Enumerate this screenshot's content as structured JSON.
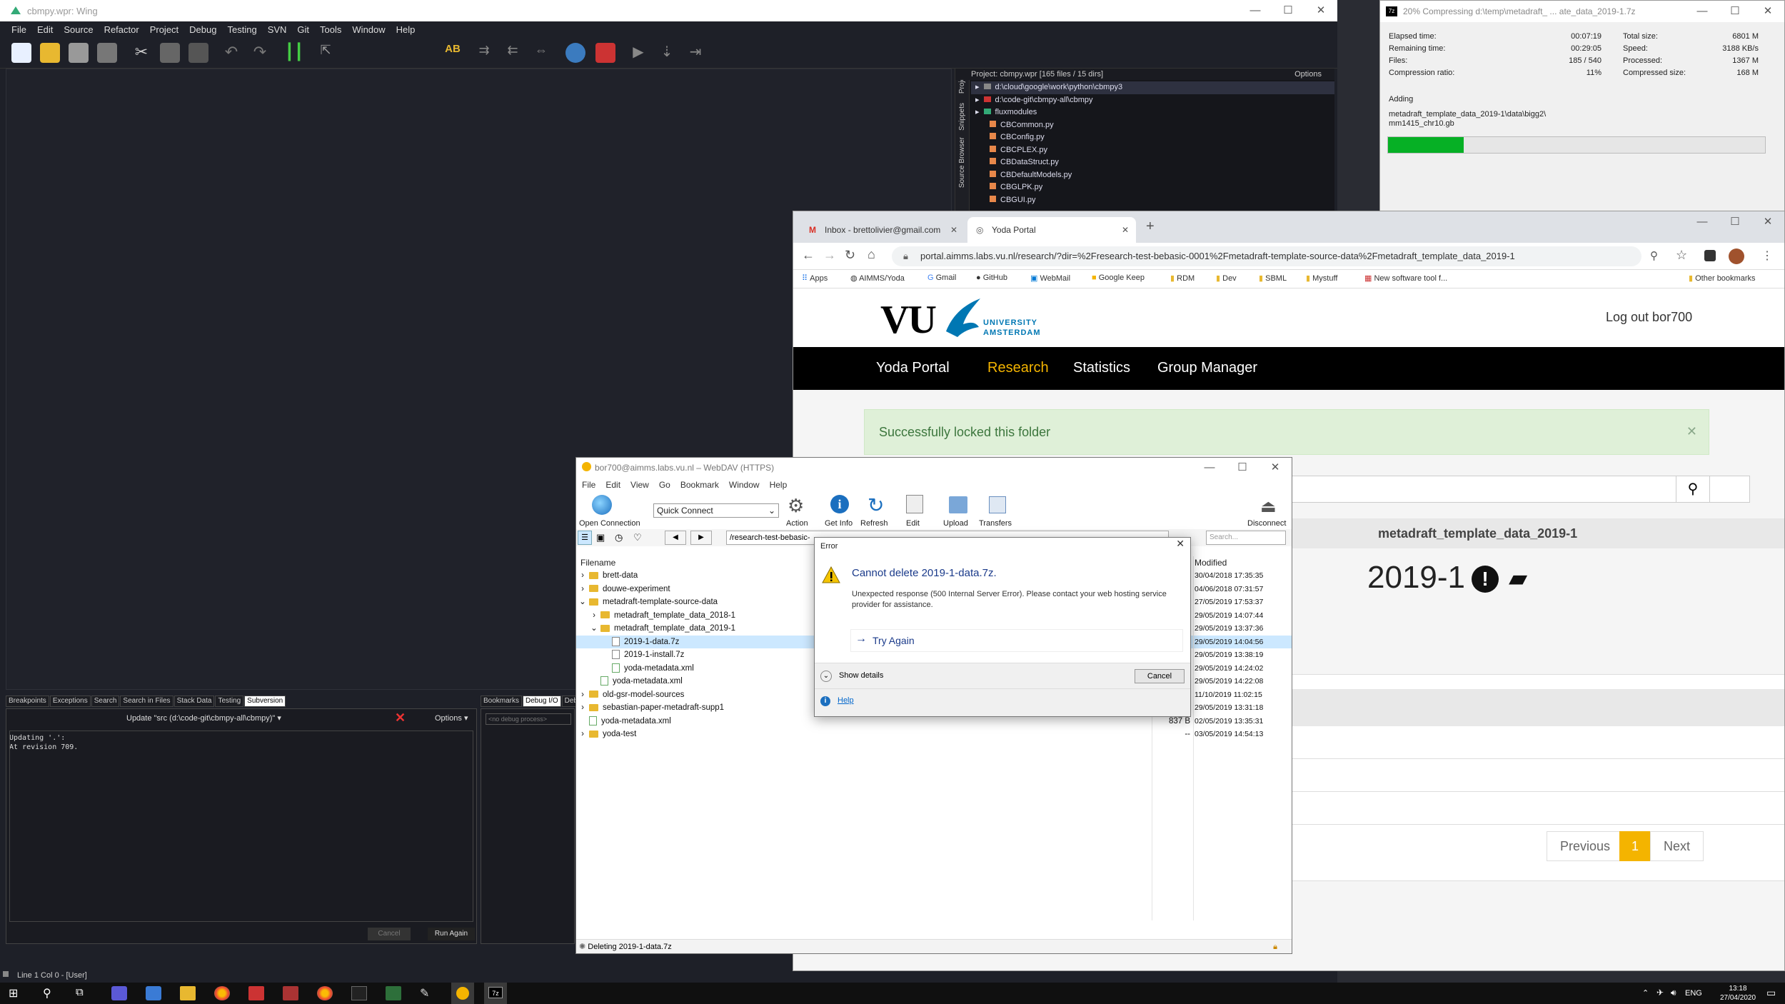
{
  "wing": {
    "title": "cbmpy.wpr: Wing",
    "menu": [
      "File",
      "Edit",
      "Source",
      "Refactor",
      "Project",
      "Debug",
      "Testing",
      "SVN",
      "Git",
      "Tools",
      "Window",
      "Help"
    ],
    "project_header": "Project: cbmpy.wpr [165 files / 15 dirs]",
    "project_options": "Options",
    "project_tabs": [
      "Project",
      "Snippets",
      "Source Browser"
    ],
    "project_items": [
      "d:\\cloud\\google\\work\\python\\cbmpy3",
      "d:\\code-git\\cbmpy-all\\cbmpy",
      "fluxmodules",
      "CBCommon.py",
      "CBConfig.py",
      "CBCPLEX.py",
      "CBDataStruct.py",
      "CBDefaultModels.py",
      "CBGLPK.py",
      "CBGUI.py"
    ],
    "bottom_tabs": [
      "Breakpoints",
      "Exceptions",
      "Search",
      "Search in Files",
      "Stack Data",
      "Testing",
      "Subversion"
    ],
    "bottom_tabs_right": [
      "Bookmarks",
      "Debug I/O",
      "Debu"
    ],
    "svn_command": "Update \"src (d:\\code-git\\cbmpy-all\\cbmpy)\"",
    "svn_options": "Options",
    "svn_output": [
      "Updating '.':",
      "At revision 709."
    ],
    "debug_process": "<no debug process>",
    "cancel_label": "Cancel",
    "run_again_label": "Run Again",
    "status": "Line 1 Col 0 - [User]"
  },
  "sevenzip": {
    "title": "20% Compressing d:\\temp\\metadraft_ ... ate_data_2019-1.7z",
    "left": [
      {
        "k": "Elapsed time:",
        "v": "00:07:19"
      },
      {
        "k": "Remaining time:",
        "v": "00:29:05"
      },
      {
        "k": "Files:",
        "v": "185 / 540"
      },
      {
        "k": "Compression ratio:",
        "v": "11%"
      }
    ],
    "right": [
      {
        "k": "Total size:",
        "v": "6801 M"
      },
      {
        "k": "Speed:",
        "v": "3188 KB/s"
      },
      {
        "k": "Processed:",
        "v": "1367 M"
      },
      {
        "k": "Compressed size:",
        "v": "168 M"
      }
    ],
    "adding_label": "Adding",
    "adding_path1": "metadraft_template_data_2019-1\\data\\bigg2\\",
    "adding_path2": "mm1415_chr10.gb",
    "progress": 0.2
  },
  "chrome": {
    "tabs": [
      {
        "label": "Inbox - brettolivier@gmail.com"
      },
      {
        "label": "Yoda Portal"
      }
    ],
    "url": "portal.aimms.labs.vu.nl/research/?dir=%2Fresearch-test-bebasic-0001%2Fmetadraft-template-source-data%2Fmetadraft_template_data_2019-1",
    "bookmarks": [
      "Apps",
      "AIMMS/Yoda",
      "Gmail",
      "GitHub",
      "WebMail",
      "Google Keep",
      "RDM",
      "Dev",
      "SBML",
      "Mystuff",
      "New software tool f..."
    ],
    "other_bookmarks": "Other bookmarks"
  },
  "yoda": {
    "logo_text": "VU",
    "logo_sub1": "UNIVERSITY",
    "logo_sub2": "AMSTERDAM",
    "logout": "Log out bor700",
    "nav": [
      "Yoda Portal",
      "Research",
      "Statistics",
      "Group Manager"
    ],
    "alert": "Successfully locked this folder",
    "breadcrumb_tail": "metadraft_template_data_2019-1",
    "folder_title_tail": "2019-1",
    "pagination": {
      "previous": "Previous",
      "current": "1",
      "next": "Next"
    }
  },
  "duck": {
    "title": "bor700@aimms.labs.vu.nl – WebDAV (HTTPS)",
    "menu": [
      "File",
      "Edit",
      "View",
      "Go",
      "Bookmark",
      "Window",
      "Help"
    ],
    "toolbar": {
      "open_connection": "Open Connection",
      "quick_connect": "Quick Connect",
      "action": "Action",
      "get_info": "Get Info",
      "refresh": "Refresh",
      "edit": "Edit",
      "upload": "Upload",
      "transfers": "Transfers",
      "disconnect": "Disconnect"
    },
    "path": "/research-test-bebasic-",
    "search_placeholder": "Search...",
    "col_filename": "Filename",
    "col_modified": "Modified",
    "rows": [
      {
        "name": "brett-data",
        "type": "folder",
        "modified": "30/04/2018 17:35:35"
      },
      {
        "name": "douwe-experiment",
        "type": "folder",
        "modified": "04/06/2018 07:31:57"
      },
      {
        "name": "metadraft-template-source-data",
        "type": "folder",
        "modified": "27/05/2019 17:53:37"
      },
      {
        "name": "metadraft_template_data_2018-1",
        "type": "folder",
        "modified": "29/05/2019 14:07:44"
      },
      {
        "name": "metadraft_template_data_2019-1",
        "type": "folder",
        "modified": "29/05/2019 13:37:36"
      },
      {
        "name": "2019-1-data.7z",
        "type": "file",
        "modified": "29/05/2019 14:04:56"
      },
      {
        "name": "2019-1-install.7z",
        "type": "file",
        "modified": "29/05/2019 13:38:19"
      },
      {
        "name": "yoda-metadata.xml",
        "type": "xml",
        "modified": "29/05/2019 14:24:02"
      },
      {
        "name": "yoda-metadata.xml",
        "type": "xml",
        "modified": "29/05/2019 14:22:08"
      },
      {
        "name": "old-gsr-model-sources",
        "type": "folder",
        "modified": "11/10/2019 11:02:15"
      },
      {
        "name": "sebastian-paper-metadraft-supp1",
        "type": "folder",
        "modified": "29/05/2019 13:31:18"
      },
      {
        "name": "yoda-metadata.xml",
        "type": "xml",
        "modified": "02/05/2019 13:35:31",
        "size": "837 B"
      },
      {
        "name": "yoda-test",
        "type": "folder",
        "modified": "03/05/2019 14:54:13",
        "size": "--"
      }
    ],
    "status": "Deleting 2019-1-data.7z"
  },
  "error": {
    "title": "Error",
    "heading": "Cannot delete 2019-1-data.7z.",
    "message": "Unexpected response (500 Internal Server Error). Please contact your web hosting service provider for assistance.",
    "try_again": "Try Again",
    "show_details": "Show details",
    "cancel": "Cancel",
    "help": "Help"
  },
  "taskbar": {
    "lang": "ENG",
    "time": "13:18",
    "date": "27/04/2020"
  },
  "colors": {
    "wing_bg": "#1e2028",
    "yoda_nav_bg": "#000000",
    "yoda_accent": "#f4b400",
    "alert_bg": "#dff0d8",
    "progress_green": "#06b025",
    "selection_blue": "#cce8ff",
    "link_blue": "#0066cc"
  }
}
